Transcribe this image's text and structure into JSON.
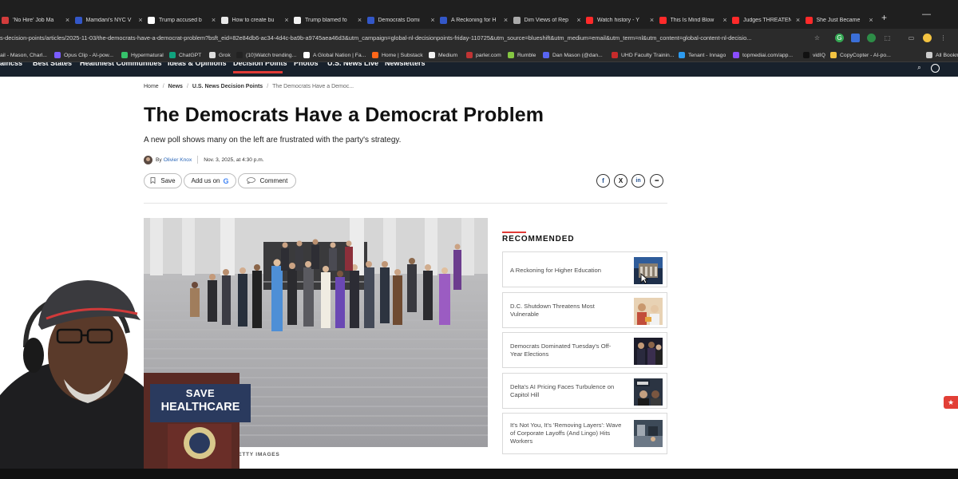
{
  "browser": {
    "tabs": [
      {
        "title": "'No Hire' Job Ma",
        "fav": "#d33c3c"
      },
      {
        "title": "Mamdani's NYC V",
        "fav": "#3357c8"
      },
      {
        "title": "Trump accused b",
        "fav": "#ffffff"
      },
      {
        "title": "How to create bu",
        "fav": "#e8e8e8"
      },
      {
        "title": "Trump blamed fo",
        "fav": "#f2f2f2"
      },
      {
        "title": "Democrats Domi",
        "fav": "#3357c8"
      },
      {
        "title": "A Reckoning for H",
        "fav": "#3357c8"
      },
      {
        "title": "Dim Views of Rep",
        "fav": "#aaaaaa"
      },
      {
        "title": "Watch history - Y",
        "fav": "#ff2a2a"
      },
      {
        "title": "This Is Mind Blow",
        "fav": "#ff2a2a"
      },
      {
        "title": "Judges THREATEN",
        "fav": "#ff2a2a"
      },
      {
        "title": "She Just Became",
        "fav": "#ff2a2a"
      }
    ],
    "url": "s-decision-points/articles/2025-11-03/the-democrats-have-a-democrat-problem?bsft_eid=82e84db6-ac34-4d4c-ba9b-a9745aea46d3&utm_campaign=global-nl-decisionpoints-friday-110725&utm_source=blueshift&utm_medium=email&utm_term=nl&utm_content=global-content-nl-decisio...",
    "bookmarks": [
      {
        "label": "ail - Mason, Charl...",
        "fav": "#d44638"
      },
      {
        "label": "Opus Clip - AI-pow...",
        "fav": "#7a5cff"
      },
      {
        "label": "Hypermatural",
        "fav": "#36c26b"
      },
      {
        "label": "ChatGPT",
        "fav": "#10a37f"
      },
      {
        "label": "Grok",
        "fav": "#dddddd"
      },
      {
        "label": "(10)Watch trending...",
        "fav": "#222222"
      },
      {
        "label": "A Global Nation | Fa...",
        "fav": "#ffffff"
      },
      {
        "label": "Home | Substack",
        "fav": "#ff6719"
      },
      {
        "label": "Medium",
        "fav": "#f0f0f0"
      },
      {
        "label": "parler.com",
        "fav": "#c03434"
      },
      {
        "label": "Rumble",
        "fav": "#85c742"
      },
      {
        "label": "Dan Mason (@dan...",
        "fav": "#5865f2"
      },
      {
        "label": "UHD Faculty Trainin...",
        "fav": "#c72b2b"
      },
      {
        "label": "Tenant - Innago",
        "fav": "#2d9bf0"
      },
      {
        "label": "topmediai.com/app...",
        "fav": "#8a4dff"
      },
      {
        "label": "vidIQ",
        "fav": "#111111"
      },
      {
        "label": "CopyCopter - AI-po...",
        "fav": "#f3c341"
      },
      {
        "label": "All Bookm",
        "fav": "#cccccc"
      }
    ]
  },
  "site_nav": {
    "items": [
      "aincss",
      "Best States",
      "Healthiest Communities",
      "Ideas & Opinions",
      "Decision Points",
      "Photos",
      "U.S. News Live",
      "Newsletters"
    ],
    "active_index": 4
  },
  "article": {
    "breadcrumbs": [
      "Home",
      "News",
      "U.S. News Decision Points",
      "The Democrats Have a Democ..."
    ],
    "headline": "The Democrats Have a Democrat Problem",
    "dek": "A new poll shows many on the left are frustrated with the party's strategy.",
    "byline_prefix": "By",
    "author": "Olivier Knox",
    "date": "Nov. 3, 2025, at 4:30 p.m.",
    "actions": {
      "save": "Save",
      "add_us_on": "Add us on",
      "comment": "Comment"
    },
    "share": {
      "facebook": "f",
      "x": "X",
      "linkedin": "in",
      "more": "•••"
    },
    "photo_credit": "ER | ANADOLU | GETTY IMAGES"
  },
  "recommended": {
    "title": "RECOMMENDED",
    "items": [
      {
        "title": "A Reckoning for Higher Education"
      },
      {
        "title": "D.C. Shutdown Threatens Most Vulnerable"
      },
      {
        "title": "Democrats Dominated Tuesday's Off-Year Elections"
      },
      {
        "title": "Delta's AI Pricing Faces Turbulence on Capitol Hill"
      },
      {
        "title": "It's Not You, It's 'Removing Layers': Wave of Corporate Layoffs (And Lingo) Hits Workers"
      }
    ]
  },
  "webcam_overlay": {
    "podium_line1": "SAVE",
    "podium_line2": "HEALTHCARE"
  },
  "colors": {
    "accent": "#e13a36",
    "nav_bg": "#18212c",
    "link": "#2a66b8"
  }
}
